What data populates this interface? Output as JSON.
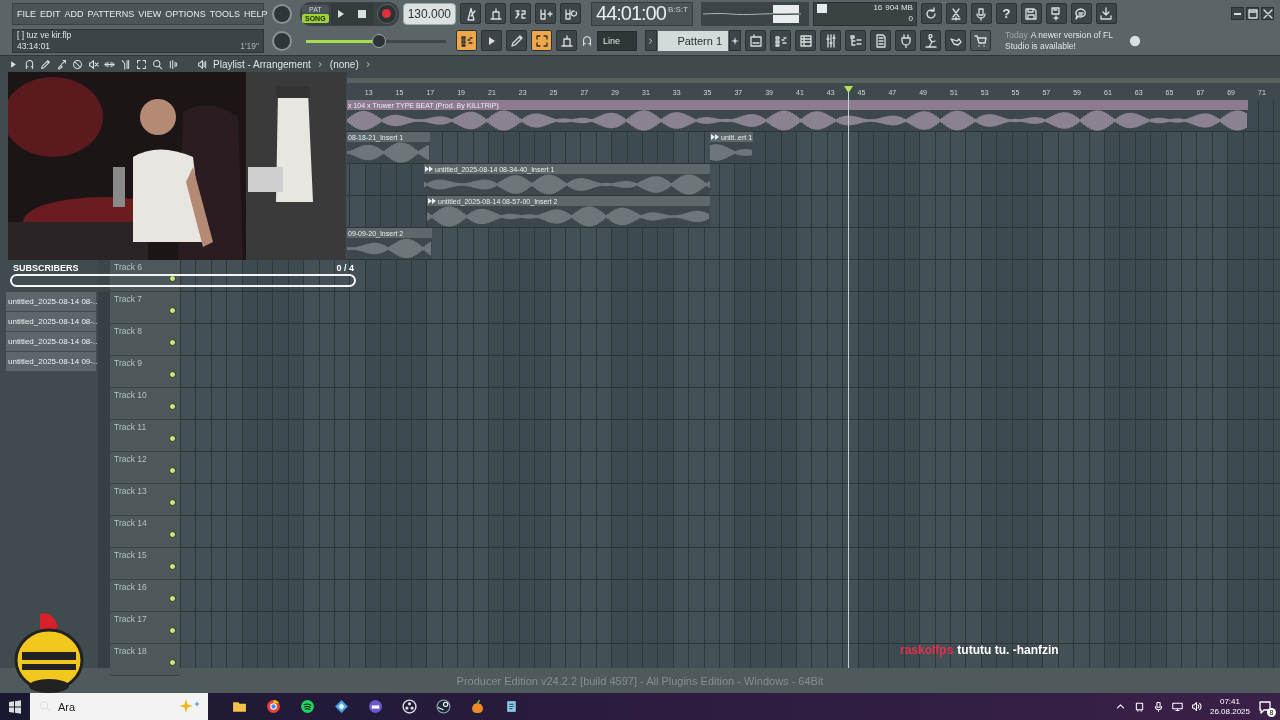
{
  "menu": [
    "FILE",
    "EDIT",
    "ADD",
    "PATTERNS",
    "VIEW",
    "OPTIONS",
    "TOOLS",
    "HELP"
  ],
  "project": {
    "name": "[ ] tuz ve kir.flp",
    "time": "43:14:01",
    "duration": "1'19\""
  },
  "modes": [
    {
      "label": "PAT",
      "selected": false
    },
    {
      "label": "SONG",
      "selected": true
    }
  ],
  "tempo": "130.000",
  "time": {
    "value": "44:01:00",
    "unit": "B:S:T"
  },
  "cpu": {
    "polyphony": "16",
    "memory": "904 MB",
    "voices": "0"
  },
  "help_button": "?",
  "master_volume": {
    "level": 0.52
  },
  "toggles": [
    {
      "on": true
    },
    {
      "on": false
    },
    {
      "on": false
    },
    {
      "on": true
    },
    {
      "on": false
    }
  ],
  "snap": "Line",
  "pattern": "Pattern 1",
  "news": {
    "when": "Today",
    "text": "A newer version of FL Studio is available!"
  },
  "playlist": {
    "title": "Playlist - Arrangement",
    "clip_source": "(none)",
    "ruler": [
      "13",
      "15",
      "17",
      "19",
      "21",
      "23",
      "25",
      "27",
      "29",
      "31",
      "33",
      "35",
      "37",
      "39",
      "41",
      "43",
      "45",
      "47",
      "49",
      "51",
      "53",
      "55",
      "57",
      "59",
      "61",
      "63",
      "65",
      "67",
      "69",
      "71"
    ],
    "clip_rows": [
      [
        {
          "label": "x 104 x Truwer TYPE BEAT (Prod. By KILLTRIP)",
          "color": "#8e7b90"
        }
      ],
      [
        {
          "label": "08-18-21_Insert 1",
          "color": "#5d686b"
        },
        {
          "label": "untit..ert 1",
          "color": "#5d686b"
        }
      ],
      [
        {
          "label": "untitled_2025-08-14 08-34-40_Insert 1",
          "color": "#5d686b"
        }
      ],
      [
        {
          "label": "untitled_2025-08-14 08-57-00_Insert 2",
          "color": "#5d686b"
        }
      ],
      [
        {
          "label": "09-09-20_Insert 2",
          "color": "#5d686b"
        }
      ]
    ],
    "track_headers": [
      {
        "label": "Track 6",
        "enabled": true
      },
      {
        "label": "Track 7",
        "enabled": true
      },
      {
        "label": "Track 8",
        "enabled": true
      },
      {
        "label": "Track 9",
        "enabled": true
      },
      {
        "label": "Track 10",
        "enabled": true
      },
      {
        "label": "Track 11",
        "enabled": true
      },
      {
        "label": "Track 12",
        "enabled": true
      },
      {
        "label": "Track 13",
        "enabled": true
      },
      {
        "label": "Track 14",
        "enabled": true
      },
      {
        "label": "Track 15",
        "enabled": true
      },
      {
        "label": "Track 16",
        "enabled": true
      },
      {
        "label": "Track 17",
        "enabled": true
      },
      {
        "label": "Track 18",
        "enabled": true
      }
    ]
  },
  "browser": {
    "items": [
      "untitled_2025-08-14 08-...",
      "untitled_2025-08-14 08-...",
      "untitled_2025-08-14 08-...",
      "untitled_2025-08-14 09-..."
    ]
  },
  "overlay": {
    "subscribers": {
      "label": "SUBSCRIBERS",
      "count": "0 / 4",
      "level": 0
    },
    "chat": {
      "user": "raskolfps",
      "message": "tututu tu. -hanfzin"
    }
  },
  "status": "Producer Edition v24.2.2 [build 4597] - All Plugins Edition - Windows - 64Bit",
  "taskbar": {
    "placeholder": "Ara",
    "time": "07:41",
    "date": "26.08.2025",
    "notifications": "8"
  }
}
